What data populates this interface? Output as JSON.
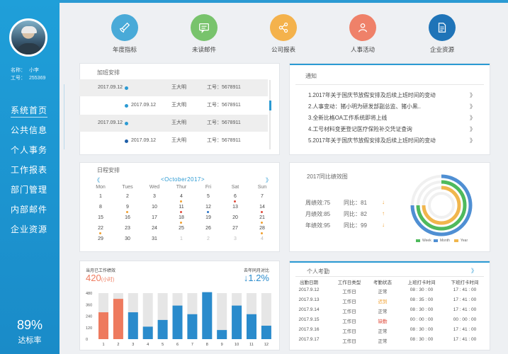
{
  "sidebar": {
    "user": {
      "name_label": "名称：",
      "name": "小李",
      "id_label": "工号：",
      "id": "255369"
    },
    "nav": [
      "系统首页",
      "公共信息",
      "个人事务",
      "工作报表",
      "部门管理",
      "内部邮件",
      "企业资源"
    ],
    "rate_value": "89%",
    "rate_label": "达标率"
  },
  "quick_links": [
    {
      "label": "年度指标",
      "icon": "rocket-icon",
      "color": "#49aad8"
    },
    {
      "label": "未读邮件",
      "icon": "mail-icon",
      "color": "#78c36c"
    },
    {
      "label": "公司报表",
      "icon": "share-icon",
      "color": "#f4b24c"
    },
    {
      "label": "人事活动",
      "icon": "person-icon",
      "color": "#ef8169"
    },
    {
      "label": "企业资源",
      "icon": "document-icon",
      "color": "#1f74b8"
    }
  ],
  "overtime": {
    "title": "加班安排",
    "rows": [
      {
        "date": "2017.09.12",
        "name": "王大明",
        "id": "工号：5678911"
      },
      {
        "date": "2017.09.12",
        "name": "王大明",
        "id": "工号：5678911"
      },
      {
        "date": "2017.09.12",
        "name": "王大明",
        "id": "工号：5678911"
      },
      {
        "date": "2017.09.12",
        "name": "王大明",
        "id": "工号：5678911"
      }
    ]
  },
  "notice": {
    "title": "通知",
    "arrow": "》",
    "items": [
      "1.2017年关于国庆节放假安排及后续上班时间的变动",
      "2.人事变动：猪小明为研发部副总监、猪小黑..",
      "3.全新比格OA工作系统即将上线",
      "4.工号材料变更登记医疗保险补交凭证查询",
      "5.2017年关于国庆节放假安排及后续上班时间的变动"
    ]
  },
  "calendar": {
    "title": "日程安排",
    "month": "<October2017>",
    "prev": "《",
    "next": "》",
    "weekdays": [
      "Mon",
      "Tues",
      "Wed",
      "Thur",
      "Fri",
      "Sat",
      "Sun"
    ],
    "weeks": [
      [
        "1",
        "2",
        "3",
        "4",
        "5",
        "6",
        "7"
      ],
      [
        "8",
        "9",
        "10",
        "11",
        "12",
        "13",
        "14"
      ],
      [
        "15",
        "16",
        "17",
        "18",
        "19",
        "20",
        "21"
      ],
      [
        "22",
        "23",
        "24",
        "25",
        "26",
        "27",
        "28"
      ],
      [
        "29",
        "30",
        "31",
        "1",
        "2",
        "3",
        "4"
      ]
    ],
    "marked_colors": {
      "orange": "#f0a030",
      "red": "#e04a3a",
      "blue": "#2b73c6"
    }
  },
  "performance": {
    "title": "2017同比绩效图",
    "rows": [
      {
        "label": "周绩效:75",
        "compare": "同比：81",
        "arrow": "↓"
      },
      {
        "label": "月绩效:85",
        "compare": "同比：82",
        "arrow": "↑"
      },
      {
        "label": "年绩效:95",
        "compare": "同比：99",
        "arrow": "↓"
      }
    ],
    "legend": [
      {
        "name": "Week",
        "color": "#4fba5d"
      },
      {
        "name": "Month",
        "color": "#4f8fd3"
      },
      {
        "name": "Year",
        "color": "#f0b64d"
      }
    ]
  },
  "work_chart": {
    "left_title": "当月已工作绩效",
    "left_value": "420",
    "left_unit": "(小时)",
    "right_title": "去年同月对比",
    "right_value": "↓1.2%"
  },
  "chart_data": {
    "type": "bar",
    "categories": [
      "1",
      "2",
      "3",
      "4",
      "5",
      "6",
      "7",
      "8",
      "9",
      "10",
      "11",
      "12"
    ],
    "series": [
      {
        "values": [
          280,
          420,
          280,
          130,
          200,
          350,
          260,
          490,
          95,
          350,
          260,
          140
        ],
        "colors": [
          "#ee7a5e",
          "#ee7a5e",
          "#2a8bcc",
          "#2a8bcc",
          "#2a8bcc",
          "#2a8bcc",
          "#2a8bcc",
          "#2a8bcc",
          "#2a8bcc",
          "#2a8bcc",
          "#2a8bcc",
          "#2a8bcc"
        ]
      }
    ],
    "background_bar": 480,
    "yticks": [
      "480",
      "360",
      "240",
      "120",
      "0"
    ],
    "ylim": [
      0,
      480
    ],
    "grid": false
  },
  "attendance": {
    "title": "个人考勤",
    "arrow": "》",
    "headers": [
      "出勤日期",
      "工作日类型",
      "考勤状态",
      "上班打卡时间",
      "下班打卡时间"
    ],
    "rows": [
      [
        "2017.9.12",
        "工作日",
        "正常",
        "08 : 30 : 00",
        "17 : 41 : 00"
      ],
      [
        "2017.9.13",
        "工作日",
        "迟到",
        "08 : 35 : 00",
        "17 : 41 : 00"
      ],
      [
        "2017.9.14",
        "工作日",
        "正常",
        "08 : 30 : 00",
        "17 : 41 : 00"
      ],
      [
        "2017.9.15",
        "工作日",
        "缺勤",
        "00 : 00 : 00",
        "00 : 00 : 00"
      ],
      [
        "2017.9.16",
        "工作日",
        "正常",
        "08 : 30 : 00",
        "17 : 41 : 00"
      ],
      [
        "2017.9.17",
        "工作日",
        "正常",
        "08 : 30 : 00",
        "17 : 41 : 00"
      ]
    ],
    "status_colors": {
      "正常": "#555555",
      "迟到": "#f0a030",
      "缺勤": "#e04a3a"
    }
  }
}
